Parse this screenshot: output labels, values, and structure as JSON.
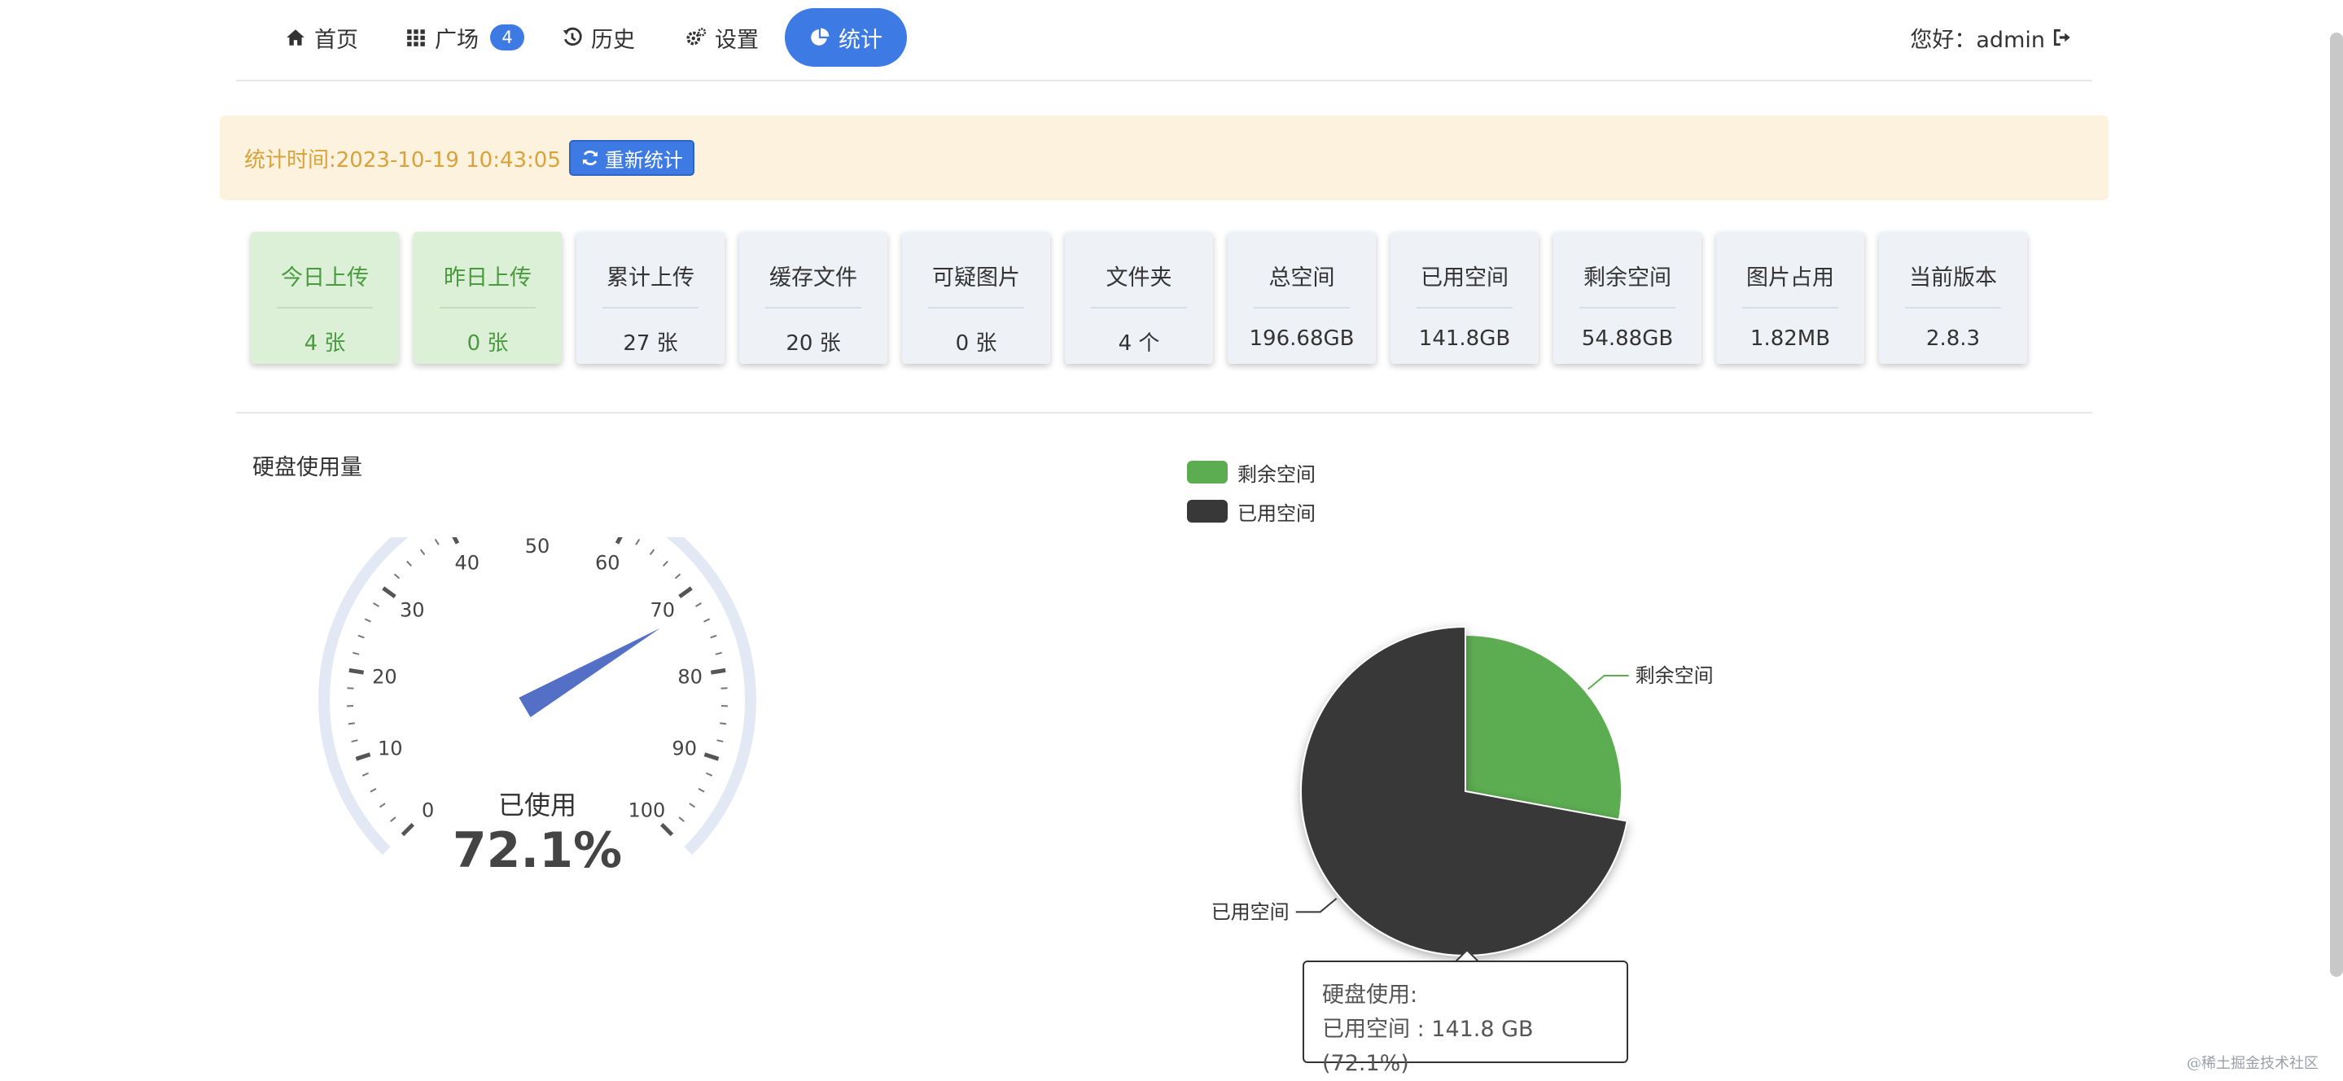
{
  "nav": {
    "items": [
      {
        "label": "首页",
        "icon": "home-icon"
      },
      {
        "label": "广场",
        "icon": "grid-icon",
        "badge": "4"
      },
      {
        "label": "历史",
        "icon": "history-icon"
      },
      {
        "label": "设置",
        "icon": "gears-icon"
      },
      {
        "label": "统计",
        "icon": "pie-chart-icon",
        "active": true
      }
    ],
    "user": "您好：admin"
  },
  "banner": {
    "text": "统计时间:2023-10-19 10:43:05",
    "refresh_label": "重新统计"
  },
  "cards": [
    {
      "label": "今日上传",
      "value": "4 张",
      "highlight": true
    },
    {
      "label": "昨日上传",
      "value": "0 张",
      "highlight": true
    },
    {
      "label": "累计上传",
      "value": "27 张"
    },
    {
      "label": "缓存文件",
      "value": "20 张"
    },
    {
      "label": "可疑图片",
      "value": "0 张"
    },
    {
      "label": "文件夹",
      "value": "4 个"
    },
    {
      "label": "总空间",
      "value": "196.68GB"
    },
    {
      "label": "已用空间",
      "value": "141.8GB"
    },
    {
      "label": "剩余空间",
      "value": "54.88GB"
    },
    {
      "label": "图片占用",
      "value": "1.82MB"
    },
    {
      "label": "当前版本",
      "value": "2.8.3"
    }
  ],
  "gauge": {
    "section_title": "硬盘使用量",
    "label": "已使用",
    "value_text": "72.1%",
    "value": 72.1,
    "min": 0,
    "max": 100,
    "tick_labels": [
      "0",
      "10",
      "20",
      "30",
      "40",
      "50",
      "60",
      "70",
      "80",
      "90",
      "100"
    ],
    "pointer_color": "#5470c6"
  },
  "pie": {
    "legend": [
      {
        "name": "剩余空间",
        "color": "#5cad51"
      },
      {
        "name": "已用空间",
        "color": "#383838"
      }
    ],
    "slices": [
      {
        "name": "剩余空间",
        "value": 54.88,
        "percent": 27.9,
        "color": "#5cad51"
      },
      {
        "name": "已用空间",
        "value": 141.8,
        "percent": 72.1,
        "color": "#383838"
      }
    ],
    "tooltip": {
      "title": "硬盘使用:",
      "line": "已用空间 : 141.8 GB (72.1%)"
    }
  },
  "watermark": "@稀土掘金技术社区"
}
